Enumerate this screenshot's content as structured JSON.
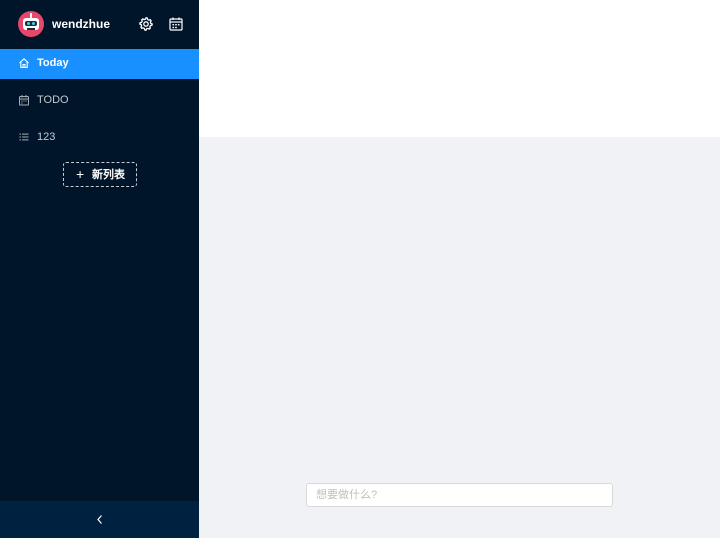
{
  "user": {
    "name": "wendzhue",
    "avatar_icon": "robot-avatar-icon"
  },
  "header_icons": [
    {
      "name": "settings-icon",
      "icon": "gear"
    },
    {
      "name": "calendar-icon",
      "icon": "calendar"
    }
  ],
  "menu": {
    "items": [
      {
        "label": "Today",
        "icon": "home",
        "active": true
      },
      {
        "label": "TODO",
        "icon": "calendar",
        "active": false
      },
      {
        "label": "123",
        "icon": "list",
        "active": false
      }
    ],
    "new_list_label": "新列表",
    "new_list_icon": "plus"
  },
  "footer": {
    "collapse_icon": "chevron-left"
  },
  "task_input": {
    "placeholder": "想要做什么?",
    "value": ""
  },
  "colors": {
    "sidebar_bg": "#001529",
    "active_item_bg": "#1890ff",
    "collapse_bar_bg": "#002140",
    "content_bg": "#f0f2f5",
    "header_bg": "#ffffff",
    "avatar_bg": "#e8476c"
  }
}
